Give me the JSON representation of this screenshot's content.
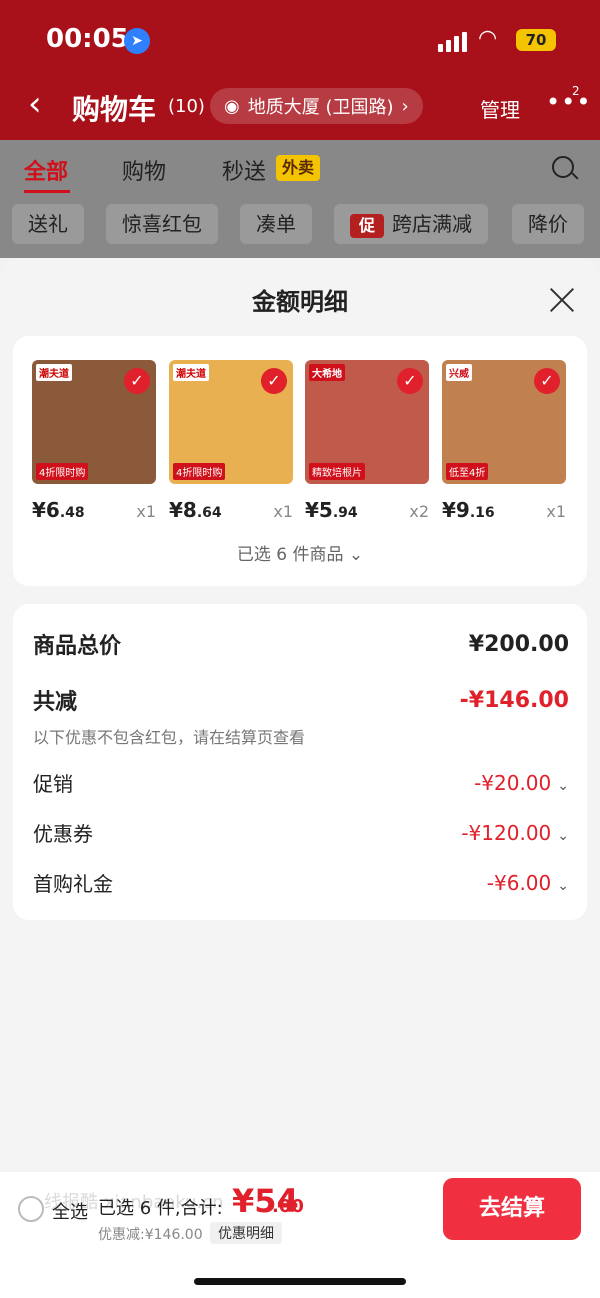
{
  "status_bar": {
    "time": "00:05",
    "battery": "70"
  },
  "nav": {
    "title": "购物车",
    "count": "(10)",
    "address": "地质大厦 (卫国路)",
    "manage": "管理",
    "more_badge": "2"
  },
  "tabs": [
    {
      "label": "全部"
    },
    {
      "label": "购物"
    },
    {
      "label": "秒送"
    }
  ],
  "tab_badge": "外卖",
  "chips": [
    "送礼",
    "惊喜红包",
    "凑单",
    "跨店满减",
    "降价"
  ],
  "chip_cu": "促",
  "sheet": {
    "title": "金额明细",
    "products": [
      {
        "int": "¥6",
        "dec": ".48",
        "qty": "x1",
        "tag": "潮夫道",
        "label": "4折限时购",
        "bg": "#8a5a3a"
      },
      {
        "int": "¥8",
        "dec": ".64",
        "qty": "x1",
        "tag": "潮夫道",
        "label": "4折限时购",
        "bg": "#e8b050"
      },
      {
        "int": "¥5",
        "dec": ".94",
        "qty": "x2",
        "tag": "大希地",
        "label": "精致培根片",
        "bg": "#c05a4a"
      },
      {
        "int": "¥9",
        "dec": ".16",
        "qty": "x1",
        "tag": "兴威",
        "label": "低至4折",
        "bg": "#c08050"
      }
    ],
    "selected_text": "已选 6 件商品"
  },
  "summary": {
    "total_label": "商品总价",
    "total_value": "¥200.00",
    "reduce_label": "共减",
    "reduce_value": "-¥146.00",
    "note": "以下优惠不包含红包，请在结算页查看",
    "promo_label": "促销",
    "promo_value": "-¥20.00",
    "coupon_label": "优惠券",
    "coupon_value": "-¥120.00",
    "gift_label": "首购礼金",
    "gift_value": "-¥6.00"
  },
  "bottom": {
    "select_all": "全选",
    "selected_sum": "已选 6 件,合计:",
    "sum_int": "¥54",
    "sum_dec": ".00",
    "discount": "优惠减:¥146.00",
    "detail": "优惠明细",
    "watermark": "线报酷 xianbaoku.cn",
    "checkout": "去结算"
  },
  "colors": {
    "brand_red": "#e0202a",
    "header_red": "#a8101a",
    "badge_yellow": "#f4c400"
  },
  "icons": [
    "location-arrow-icon",
    "signal-icon",
    "wifi-icon",
    "back-icon",
    "eye-icon",
    "more-icon",
    "search-icon",
    "close-icon",
    "check-icon",
    "chevron-down-icon"
  ]
}
